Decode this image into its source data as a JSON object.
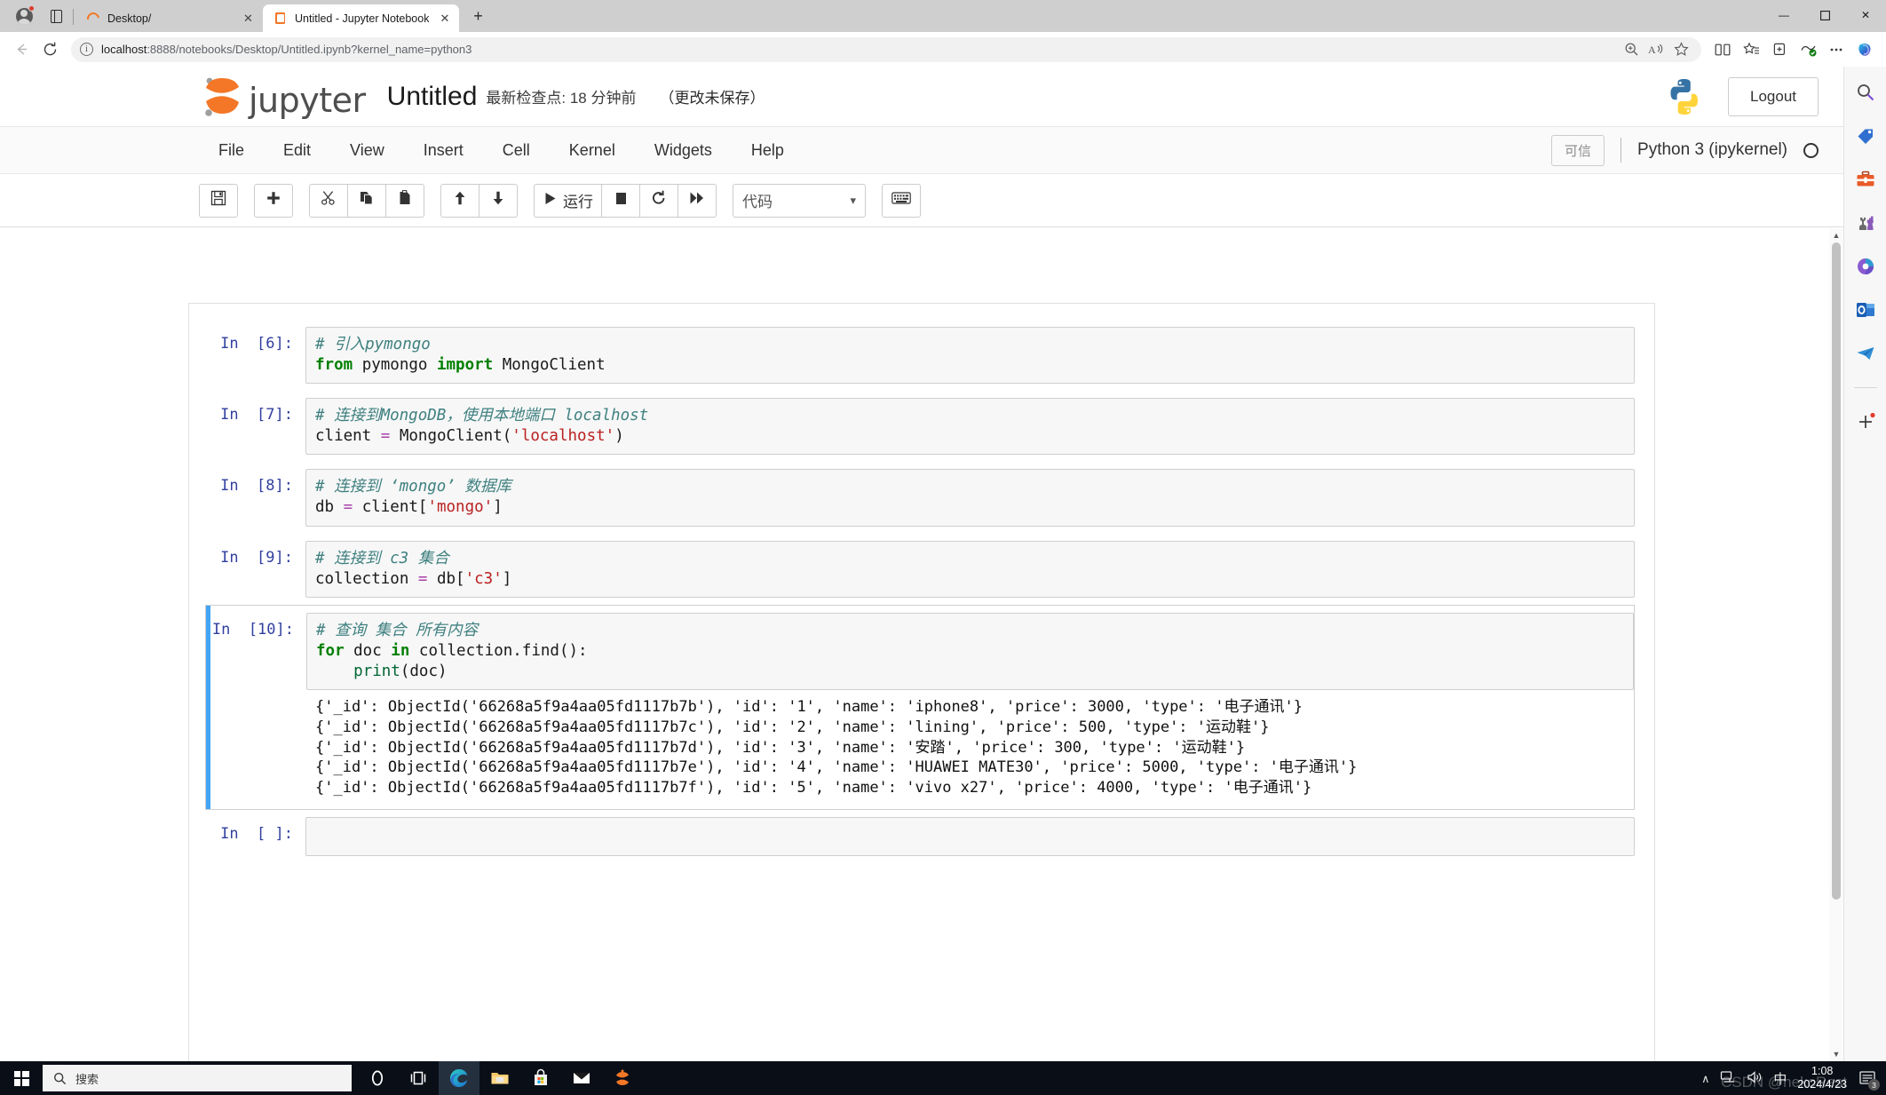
{
  "browser": {
    "tabs": [
      {
        "title": "Desktop/",
        "icon": "spinner-icon",
        "active": false
      },
      {
        "title": "Untitled - Jupyter Notebook",
        "icon": "jupyter-icon",
        "active": true
      }
    ],
    "new_tab_label": "+",
    "url_host": "localhost",
    "url_rest": ":8888/notebooks/Desktop/Untitled.ipynb?kernel_name=python3",
    "window_controls": {
      "minimize": "—",
      "maximize": "☐",
      "close": "✕"
    }
  },
  "jupyter": {
    "logo_text": "jupyter",
    "notebook_title": "Untitled",
    "checkpoint_text": "最新检查点: 18 分钟前",
    "dirty_text": "（更改未保存）",
    "logout_label": "Logout",
    "menu": [
      "File",
      "Edit",
      "View",
      "Insert",
      "Cell",
      "Kernel",
      "Widgets",
      "Help"
    ],
    "trusted_label": "可信",
    "kernel_name": "Python 3 (ipykernel)",
    "toolbar": {
      "save": "save-icon",
      "insert_below": "plus-icon",
      "cut": "scissors-icon",
      "copy": "copy-icon",
      "paste": "paste-icon",
      "move_up": "arrow-up-icon",
      "move_down": "arrow-down-icon",
      "run_label": "运行",
      "stop": "stop-icon",
      "restart": "restart-icon",
      "restart_run_all": "fast-forward-icon",
      "cell_type_value": "代码",
      "keyboard": "keyboard-icon"
    }
  },
  "notebook": {
    "cells": [
      {
        "prompt": "In  [6]:",
        "selected": false,
        "source": [
          {
            "t": "comment",
            "v": "# 引入pymongo"
          },
          {
            "t": "line",
            "parts": [
              {
                "t": "kw",
                "v": "from"
              },
              {
                "t": "plain",
                "v": " pymongo "
              },
              {
                "t": "kw",
                "v": "import"
              },
              {
                "t": "plain",
                "v": " MongoClient"
              }
            ]
          }
        ],
        "output": null
      },
      {
        "prompt": "In  [7]:",
        "selected": false,
        "source": [
          {
            "t": "comment",
            "v": "# 连接到MongoDB，使用本地端口 localhost"
          },
          {
            "t": "line",
            "parts": [
              {
                "t": "plain",
                "v": "client "
              },
              {
                "t": "op",
                "v": "="
              },
              {
                "t": "plain",
                "v": " MongoClient("
              },
              {
                "t": "str",
                "v": "'localhost'"
              },
              {
                "t": "plain",
                "v": ")"
              }
            ]
          }
        ],
        "output": null
      },
      {
        "prompt": "In  [8]:",
        "selected": false,
        "source": [
          {
            "t": "comment",
            "v": "# 连接到 ‘mongo’ 数据库"
          },
          {
            "t": "line",
            "parts": [
              {
                "t": "plain",
                "v": "db "
              },
              {
                "t": "op",
                "v": "="
              },
              {
                "t": "plain",
                "v": " client["
              },
              {
                "t": "str",
                "v": "'mongo'"
              },
              {
                "t": "plain",
                "v": "]"
              }
            ]
          }
        ],
        "output": null
      },
      {
        "prompt": "In  [9]:",
        "selected": false,
        "source": [
          {
            "t": "comment",
            "v": "# 连接到 c3 集合"
          },
          {
            "t": "line",
            "parts": [
              {
                "t": "plain",
                "v": "collection "
              },
              {
                "t": "op",
                "v": "="
              },
              {
                "t": "plain",
                "v": " db["
              },
              {
                "t": "str",
                "v": "'c3'"
              },
              {
                "t": "plain",
                "v": "]"
              }
            ]
          }
        ],
        "output": null
      },
      {
        "prompt": "In  [10]:",
        "selected": true,
        "source": [
          {
            "t": "comment",
            "v": "# 查询 集合 所有内容"
          },
          {
            "t": "line",
            "parts": [
              {
                "t": "kw",
                "v": "for"
              },
              {
                "t": "plain",
                "v": " doc "
              },
              {
                "t": "kw",
                "v": "in"
              },
              {
                "t": "plain",
                "v": " collection.find():"
              }
            ]
          },
          {
            "t": "line",
            "parts": [
              {
                "t": "plain",
                "v": "    "
              },
              {
                "t": "fn",
                "v": "print"
              },
              {
                "t": "plain",
                "v": "(doc)"
              }
            ]
          }
        ],
        "output": "{'_id': ObjectId('66268a5f9a4aa05fd1117b7b'), 'id': '1', 'name': 'iphone8', 'price': 3000, 'type': '电子通讯'}\n{'_id': ObjectId('66268a5f9a4aa05fd1117b7c'), 'id': '2', 'name': 'lining', 'price': 500, 'type': '运动鞋'}\n{'_id': ObjectId('66268a5f9a4aa05fd1117b7d'), 'id': '3', 'name': '安踏', 'price': 300, 'type': '运动鞋'}\n{'_id': ObjectId('66268a5f9a4aa05fd1117b7e'), 'id': '4', 'name': 'HUAWEI MATE30', 'price': 5000, 'type': '电子通讯'}\n{'_id': ObjectId('66268a5f9a4aa05fd1117b7f'), 'id': '5', 'name': 'vivo x27', 'price': 4000, 'type': '电子通讯'}"
      },
      {
        "prompt": "In  [ ]:",
        "selected": false,
        "source": [],
        "output": null
      }
    ]
  },
  "edge_sidebar": {
    "items": [
      "search-icon",
      "shopping-tag-icon",
      "toolbox-icon",
      "games-icon",
      "office-icon",
      "outlook-icon",
      "telegram-icon"
    ],
    "add_label": "+"
  },
  "taskbar": {
    "search_placeholder": "搜索",
    "apps": [
      "cortana-icon",
      "task-view-icon",
      "edge-icon",
      "file-explorer-icon",
      "microsoft-store-icon",
      "mail-icon",
      "jupyter-icon"
    ],
    "tray": {
      "overflow": "∧",
      "network": "network-icon",
      "volume": "volume-icon",
      "ime": "中"
    },
    "clock_time": "1:08",
    "clock_date": "2024/4/23",
    "notification_count": "3",
    "watermark": "CSDN @nekoRest"
  },
  "colors": {
    "jupyter_orange": "#f37726",
    "accent_blue": "#42a5f5",
    "prompt_blue": "#303f9f",
    "comment_teal": "#408080",
    "keyword_green": "#008000",
    "string_red": "#ba2121"
  }
}
